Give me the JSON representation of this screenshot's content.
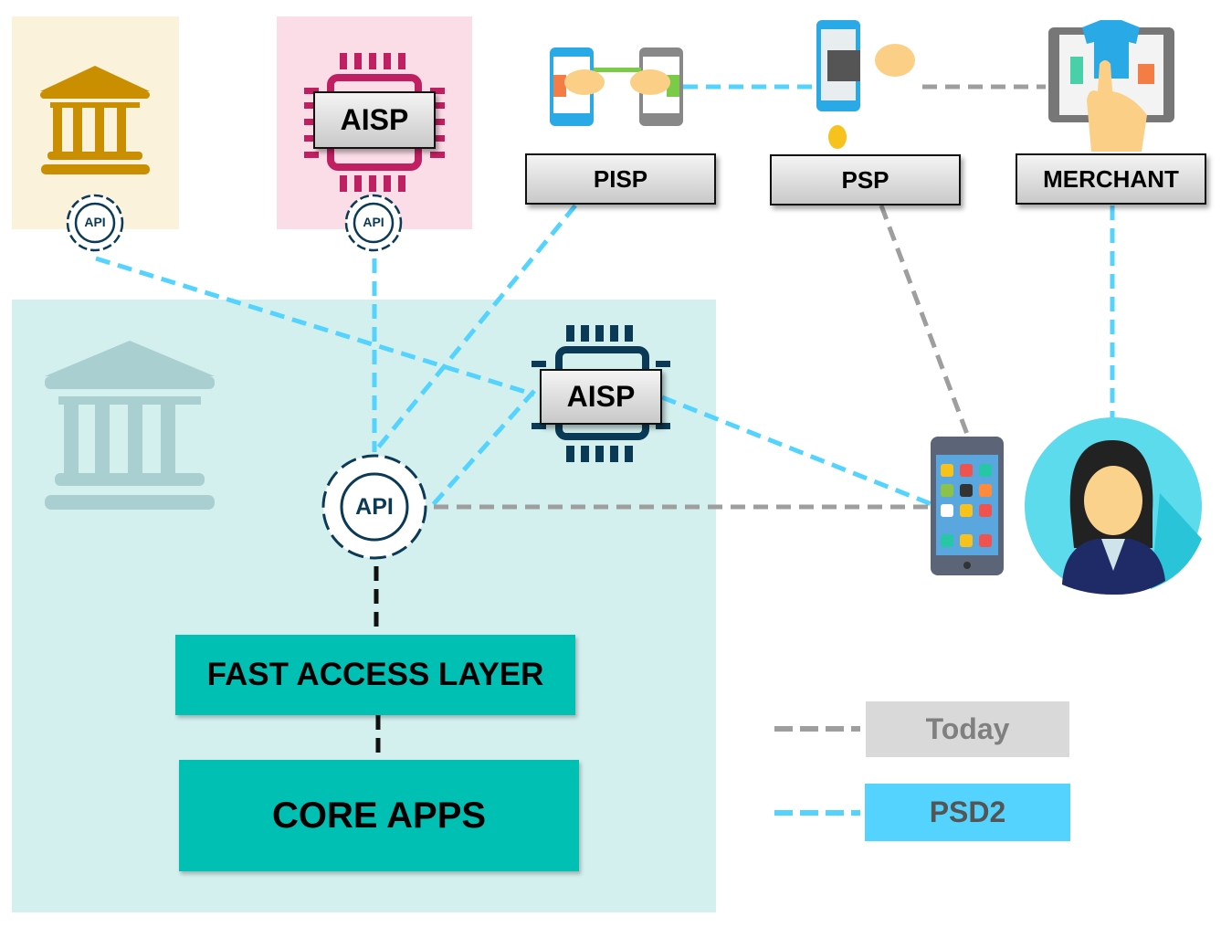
{
  "colors": {
    "psd2_line": "#55d3ff",
    "today_line": "#9e9e9e",
    "bank_panel": "#fbf2db",
    "aisp_panel": "#fbdde8",
    "core_panel": "#d3efee",
    "teal": "#00bfb3"
  },
  "nodes": {
    "aisp_top": "AISP",
    "aisp_core": "AISP",
    "pisp": "PISP",
    "psp": "PSP",
    "merchant": "MERCHANT",
    "api_small_bank": "API",
    "api_small_aisp": "API",
    "api_core": "API",
    "fast_access_layer": "FAST ACCESS LAYER",
    "core_apps": "CORE APPS"
  },
  "legend": {
    "today": "Today",
    "psd2": "PSD2"
  },
  "icons": [
    "bank-icon",
    "chip-icon",
    "api-gear-icon",
    "phone-payment-icon",
    "pos-payment-icon",
    "shopping-tablet-icon",
    "smartphone-icon",
    "user-avatar-icon"
  ]
}
